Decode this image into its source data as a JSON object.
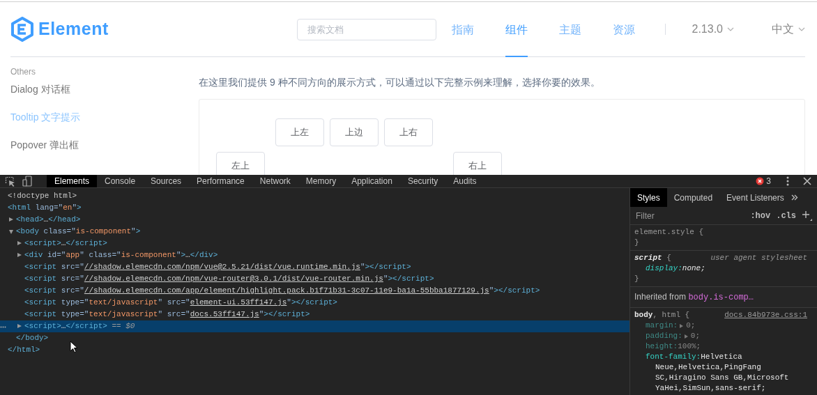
{
  "page": {
    "logo": "Element",
    "search": {
      "placeholder": "搜索文档"
    },
    "nav": [
      {
        "label": "指南",
        "selected": false
      },
      {
        "label": "组件",
        "selected": true
      },
      {
        "label": "主题",
        "selected": false
      },
      {
        "label": "资源",
        "selected": false
      }
    ],
    "version": "2.13.0",
    "language": "中文",
    "sidebar": {
      "group": "Others",
      "items": [
        {
          "label": "Dialog 对话框",
          "selected": false
        },
        {
          "label": "Tooltip 文字提示",
          "selected": true
        },
        {
          "label": "Popover 弹出框",
          "selected": false
        }
      ]
    },
    "intro": "在这里我们提供 9 种不同方向的展示方式，可以通过以下完整示例来理解，选择你要的效果。",
    "demo_rows": [
      [
        "上左",
        "上边",
        "上右"
      ],
      [
        "左上",
        "右上"
      ]
    ]
  },
  "devtools": {
    "tabs": [
      {
        "label": "Elements",
        "selected": true
      },
      {
        "label": "Console",
        "selected": false
      },
      {
        "label": "Sources",
        "selected": false
      },
      {
        "label": "Performance",
        "selected": false
      },
      {
        "label": "Network",
        "selected": false
      },
      {
        "label": "Memory",
        "selected": false
      },
      {
        "label": "Application",
        "selected": false
      },
      {
        "label": "Security",
        "selected": false
      },
      {
        "label": "Audits",
        "selected": false
      }
    ],
    "error_count": "3",
    "tree": [
      {
        "selected": false,
        "segments": [
          {
            "kind": "doctype",
            "t": "<!doctype html>"
          }
        ]
      },
      {
        "selected": false,
        "segments": [
          {
            "kind": "tag",
            "t": "<html"
          },
          {
            "kind": "attr",
            "t": " lang=\""
          },
          {
            "kind": "val",
            "t": "en"
          },
          {
            "kind": "attr",
            "t": "\""
          },
          {
            "kind": "tag",
            "t": ">"
          }
        ],
        "close": [
          {
            "kind": "tag",
            "t": "</html>"
          }
        ],
        "children": [
          {
            "selected": false,
            "expanded": false,
            "segments": [
              {
                "kind": "tag",
                "t": "<head>"
              },
              {
                "kind": "plain",
                "t": "…"
              },
              {
                "kind": "tag",
                "t": "</head>"
              }
            ]
          },
          {
            "selected": false,
            "expanded": true,
            "segments": [
              {
                "kind": "tag",
                "t": "<body"
              },
              {
                "kind": "attr",
                "t": " class=\""
              },
              {
                "kind": "val",
                "t": "is-component"
              },
              {
                "kind": "attr",
                "t": "\""
              },
              {
                "kind": "tag",
                "t": ">"
              }
            ],
            "close": [
              {
                "kind": "tag",
                "t": "</body>"
              }
            ],
            "children": [
              {
                "selected": false,
                "expanded": false,
                "segments": [
                  {
                    "kind": "tag",
                    "t": "<script>"
                  },
                  {
                    "kind": "plain",
                    "t": "…"
                  },
                  {
                    "kind": "tag",
                    "t": "</script>"
                  }
                ]
              },
              {
                "selected": false,
                "expanded": false,
                "segments": [
                  {
                    "kind": "tag",
                    "t": "<div"
                  },
                  {
                    "kind": "attr",
                    "t": " id=\""
                  },
                  {
                    "kind": "val",
                    "t": "app"
                  },
                  {
                    "kind": "attr",
                    "t": "\" class=\""
                  },
                  {
                    "kind": "val",
                    "t": "is-component"
                  },
                  {
                    "kind": "attr",
                    "t": "\""
                  },
                  {
                    "kind": "tag",
                    "t": ">"
                  },
                  {
                    "kind": "plain",
                    "t": "…"
                  },
                  {
                    "kind": "tag",
                    "t": "</div>"
                  }
                ]
              },
              {
                "selected": false,
                "segments": [
                  {
                    "kind": "tag",
                    "t": "<script"
                  },
                  {
                    "kind": "attr",
                    "t": " src=\""
                  },
                  {
                    "kind": "link",
                    "t": "//shadow.elemecdn.com/npm/vue@2.5.21/dist/vue.runtime.min.js"
                  },
                  {
                    "kind": "attr",
                    "t": "\""
                  },
                  {
                    "kind": "tag",
                    "t": "></script>"
                  }
                ]
              },
              {
                "selected": false,
                "segments": [
                  {
                    "kind": "tag",
                    "t": "<script"
                  },
                  {
                    "kind": "attr",
                    "t": " src=\""
                  },
                  {
                    "kind": "link",
                    "t": "//shadow.elemecdn.com/npm/vue-router@3.0.1/dist/vue-router.min.js"
                  },
                  {
                    "kind": "attr",
                    "t": "\""
                  },
                  {
                    "kind": "tag",
                    "t": "></script>"
                  }
                ]
              },
              {
                "selected": false,
                "segments": [
                  {
                    "kind": "tag",
                    "t": "<script"
                  },
                  {
                    "kind": "attr",
                    "t": " src=\""
                  },
                  {
                    "kind": "link",
                    "t": "//shadow.elemecdn.com/app/element/highlight.pack.b1f71b31-3c07-11e9-ba1a-55bba1877129.js"
                  },
                  {
                    "kind": "attr",
                    "t": "\""
                  },
                  {
                    "kind": "tag",
                    "t": "></script>"
                  }
                ]
              },
              {
                "selected": false,
                "segments": [
                  {
                    "kind": "tag",
                    "t": "<script"
                  },
                  {
                    "kind": "attr",
                    "t": " type=\""
                  },
                  {
                    "kind": "val",
                    "t": "text/javascript"
                  },
                  {
                    "kind": "attr",
                    "t": "\" src=\""
                  },
                  {
                    "kind": "link",
                    "t": "element-ui.53ff147.js"
                  },
                  {
                    "kind": "attr",
                    "t": "\""
                  },
                  {
                    "kind": "tag",
                    "t": "></script>"
                  }
                ]
              },
              {
                "selected": false,
                "segments": [
                  {
                    "kind": "tag",
                    "t": "<script"
                  },
                  {
                    "kind": "attr",
                    "t": " type=\""
                  },
                  {
                    "kind": "val",
                    "t": "text/javascript"
                  },
                  {
                    "kind": "attr",
                    "t": "\" src=\""
                  },
                  {
                    "kind": "link",
                    "t": "docs.53ff147.js"
                  },
                  {
                    "kind": "attr",
                    "t": "\""
                  },
                  {
                    "kind": "tag",
                    "t": "></script>"
                  }
                ]
              },
              {
                "selected": true,
                "expanded": false,
                "segments": [
                  {
                    "kind": "tag",
                    "t": "<script>"
                  },
                  {
                    "kind": "plain",
                    "t": "…"
                  },
                  {
                    "kind": "tag",
                    "t": "</script>"
                  },
                  {
                    "kind": "ref",
                    "t": " == $0"
                  }
                ]
              }
            ]
          }
        ]
      }
    ],
    "styles": {
      "tabs": [
        {
          "label": "Styles",
          "selected": true
        },
        {
          "label": "Computed",
          "selected": false
        },
        {
          "label": "Event Listeners",
          "selected": false
        }
      ],
      "filter": {
        "placeholder": "Filter"
      },
      "hov": ":hov",
      "cls": ".cls",
      "rules": [
        {
          "kind": "inline",
          "selector": [
            {
              "kind": "plain",
              "t": "element.style"
            },
            {
              "kind": "brace",
              "t": " {"
            }
          ],
          "close": "}"
        },
        {
          "kind": "ua",
          "selector": [
            {
              "kind": "match",
              "t": "script"
            },
            {
              "kind": "brace",
              "t": " {"
            }
          ],
          "source": "user agent stylesheet",
          "props": [
            {
              "name": "display:",
              "value_lines": [
                "none;"
              ],
              "dimmed": false,
              "expandable": false
            }
          ],
          "close": "}"
        },
        {
          "kind": "inherited",
          "label": "Inherited from",
          "target": "body.is-comp…"
        },
        {
          "kind": "author",
          "selector": [
            {
              "kind": "match",
              "t": "body"
            },
            {
              "kind": "plain",
              "t": ", "
            },
            {
              "kind": "nomatch",
              "t": "html"
            },
            {
              "kind": "brace",
              "t": " {"
            }
          ],
          "source": "docs.84b973e.css:1",
          "props": [
            {
              "name": "margin:",
              "value_lines": [
                "0;"
              ],
              "dimmed": true,
              "expandable": true
            },
            {
              "name": "padding:",
              "value_lines": [
                "0;"
              ],
              "dimmed": true,
              "expandable": true
            },
            {
              "name": "height:",
              "value_lines": [
                "100%;"
              ],
              "dimmed": true,
              "expandable": false
            },
            {
              "name": "font-family:",
              "value_lines": [
                "Helvetica",
                "Neue,Helvetica,PingFang",
                "SC,Hiragino Sans GB,Microsoft",
                "YaHei,SimSun,sans-serif;"
              ],
              "dimmed": false,
              "expandable": false
            }
          ]
        }
      ]
    }
  }
}
